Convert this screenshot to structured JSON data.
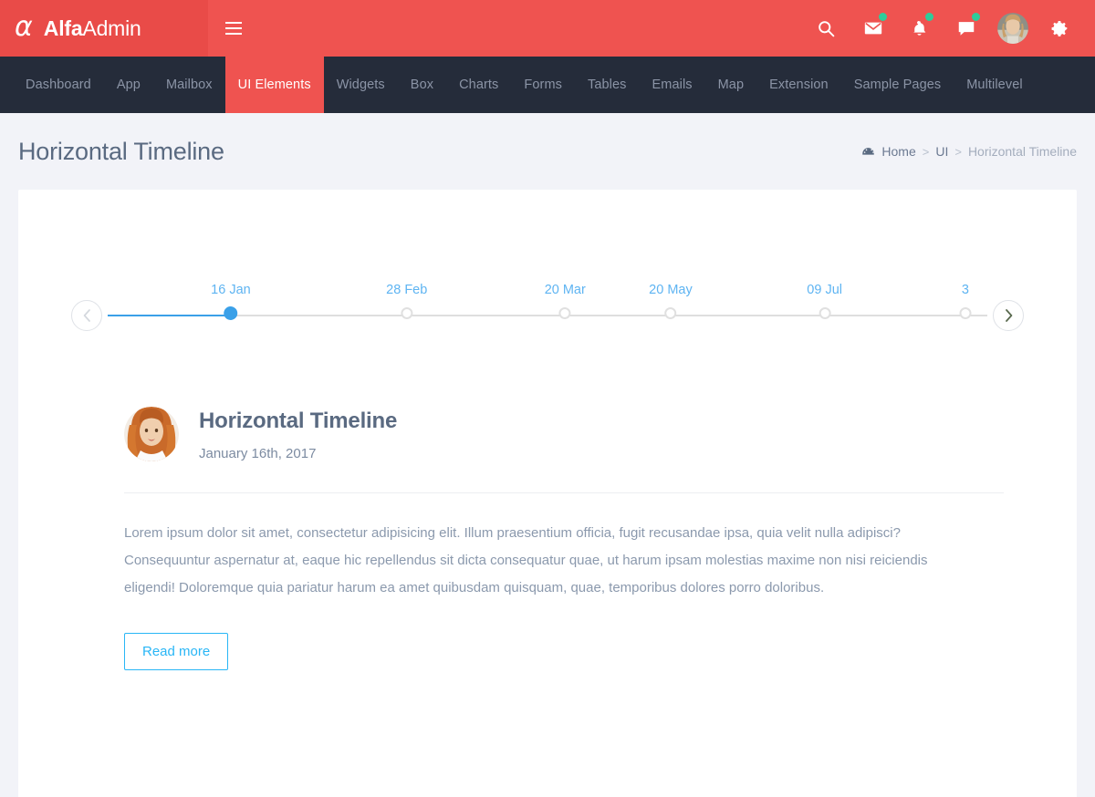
{
  "brand": {
    "logo_icon": "alpha-logo-icon",
    "name_bold": "Alfa",
    "name_light": "Admin"
  },
  "topbar": {
    "background": "#ef5350",
    "brand_background": "#e94b48",
    "menu_toggle": "hamburger-icon",
    "icons": [
      {
        "name": "search-icon",
        "badge": false
      },
      {
        "name": "mail-icon",
        "badge": true
      },
      {
        "name": "bell-icon",
        "badge": true
      },
      {
        "name": "chat-icon",
        "badge": true
      }
    ],
    "badge_color": "#2ecc9a",
    "avatar": "user-avatar",
    "settings_icon": "gear-icon"
  },
  "nav": {
    "active_color": "#ef5350",
    "background": "#252c3a",
    "items": [
      {
        "label": "Dashboard",
        "active": false
      },
      {
        "label": "App",
        "active": false
      },
      {
        "label": "Mailbox",
        "active": false
      },
      {
        "label": "UI Elements",
        "active": true
      },
      {
        "label": "Widgets",
        "active": false
      },
      {
        "label": "Box",
        "active": false
      },
      {
        "label": "Charts",
        "active": false
      },
      {
        "label": "Forms",
        "active": false
      },
      {
        "label": "Tables",
        "active": false
      },
      {
        "label": "Emails",
        "active": false
      },
      {
        "label": "Map",
        "active": false
      },
      {
        "label": "Extension",
        "active": false
      },
      {
        "label": "Sample Pages",
        "active": false
      },
      {
        "label": "Multilevel",
        "active": false
      }
    ]
  },
  "page": {
    "title": "Horizontal Timeline",
    "breadcrumb": {
      "icon": "dashboard-icon",
      "items": [
        "Home",
        "UI",
        "Horizontal Timeline"
      ],
      "separator": ">"
    }
  },
  "timeline": {
    "prev_label": "prev-arrow-icon",
    "next_label": "next-arrow-icon",
    "prev_enabled": false,
    "next_enabled": true,
    "line_color": "#dedede",
    "fill_color": "#3aa0e8",
    "label_color": "#5eb4f2",
    "points": [
      {
        "label": "16 Jan",
        "active": true,
        "pos": 14
      },
      {
        "label": "28 Feb",
        "active": false,
        "pos": 34
      },
      {
        "label": "20 Mar",
        "active": false,
        "pos": 52
      },
      {
        "label": "20 May",
        "active": false,
        "pos": 64
      },
      {
        "label": "09 Jul",
        "active": false,
        "pos": 81.5
      },
      {
        "label": "3",
        "active": false,
        "pos": 97.5
      }
    ]
  },
  "event": {
    "avatar": "author-avatar",
    "title": "Horizontal Timeline",
    "date": "January 16th, 2017",
    "body": "Lorem ipsum dolor sit amet, consectetur adipisicing elit. Illum praesentium officia, fugit recusandae ipsa, quia velit nulla adipisci? Consequuntur aspernatur at, eaque hic repellendus sit dicta consequatur quae, ut harum ipsam molestias maxime non nisi reiciendis eligendi! Doloremque quia pariatur harum ea amet quibusdam quisquam, quae, temporibus dolores porro doloribus.",
    "read_more_label": "Read more",
    "read_more_color": "#29b6f6"
  }
}
